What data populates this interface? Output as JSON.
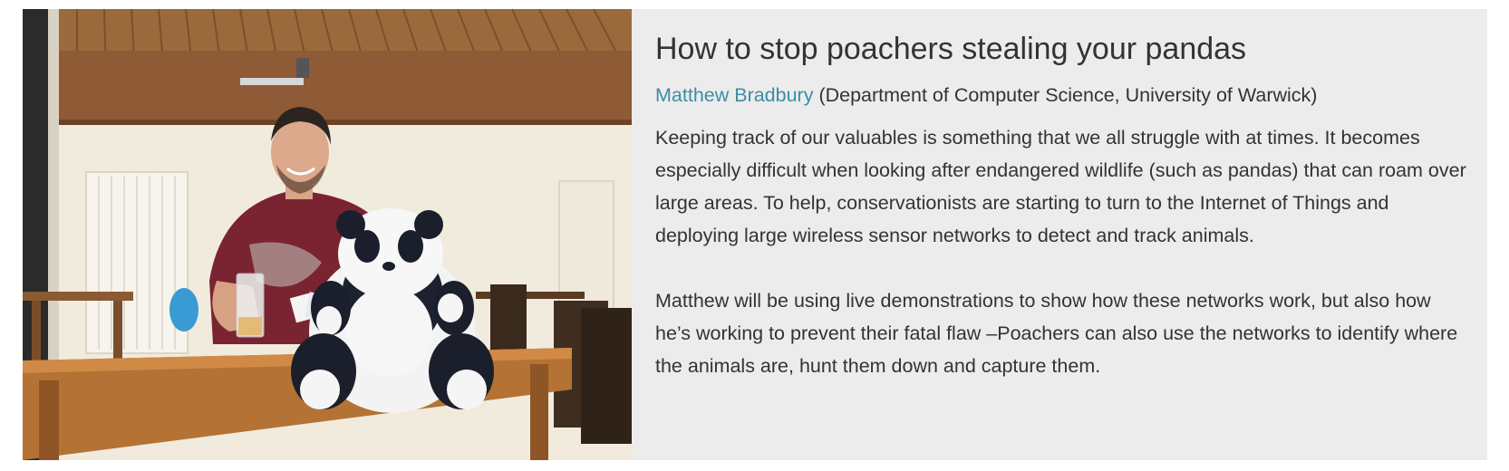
{
  "talk": {
    "title": "How to stop poachers stealing your pandas",
    "speaker": "Matthew Bradbury",
    "affiliation": "(Department of Computer Science, University of Warwick)",
    "paragraphs": [
      "Keeping track of our valuables is something that we all struggle with at times. It becomes especially difficult when looking after endangered wildlife (such as pandas) that can roam over large areas. To help, conservationists are starting to turn to the Internet of Things and deploying large wireless sensor networks to detect and track animals.",
      "Matthew will be using live demonstrations to show how these networks work, but also how he’s working to prevent their fatal flaw –Poachers can also use the networks to identify where the animals are, hunt them down and capture them."
    ]
  },
  "colors": {
    "card_background": "#ececec",
    "link": "#3b8ea5",
    "text": "#333333"
  }
}
